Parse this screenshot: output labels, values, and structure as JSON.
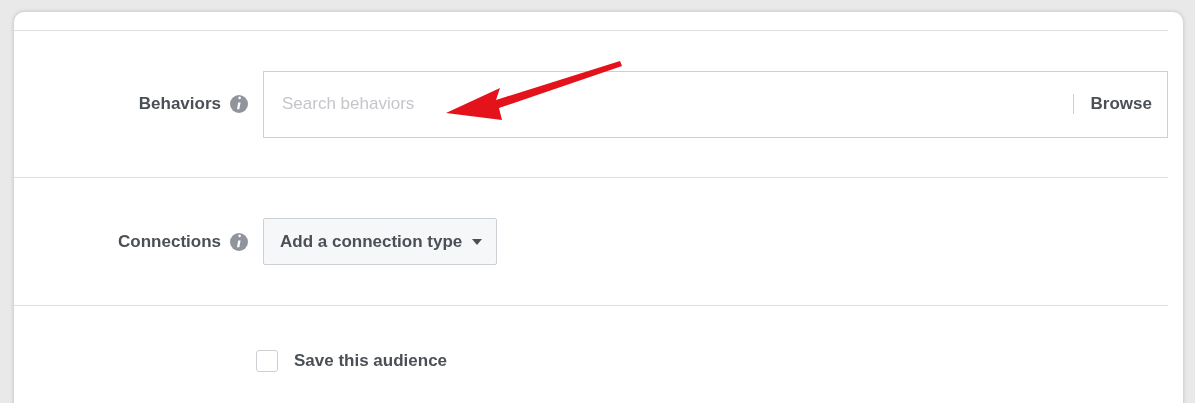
{
  "rows": [
    {
      "kind": "search",
      "label": "Behaviors",
      "placeholder": "Search behaviors",
      "action": "Browse"
    },
    {
      "kind": "dropdown",
      "label": "Connections",
      "value": "Add a connection type"
    }
  ],
  "save_audience": {
    "label": "Save this audience",
    "checked": false
  }
}
